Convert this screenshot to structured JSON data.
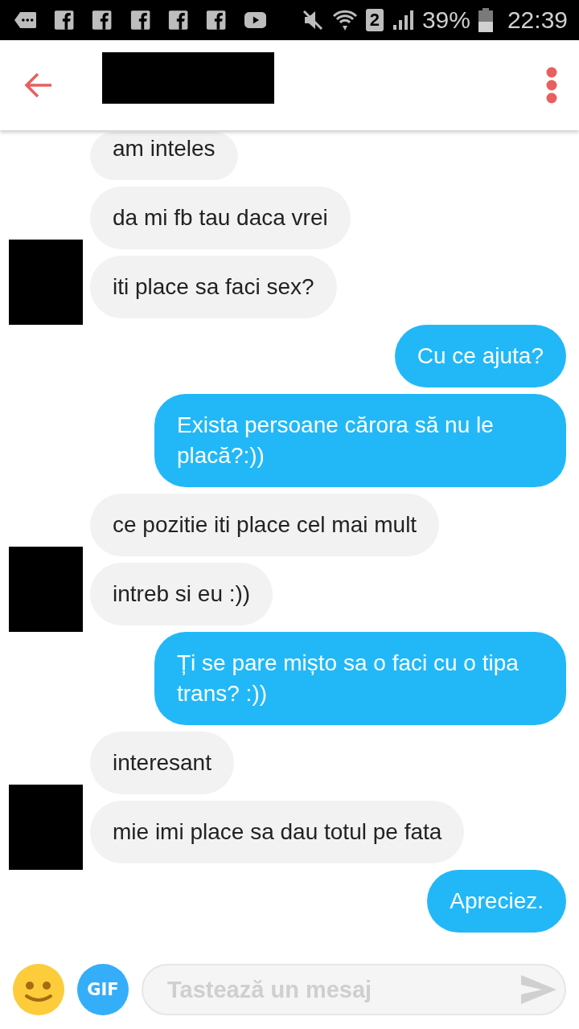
{
  "status_bar": {
    "battery": "39%",
    "time": "22:39",
    "sim": "2"
  },
  "header": {
    "name_redacted": true
  },
  "messages": [
    {
      "kind": "received",
      "text": "am inteles",
      "partial": true,
      "avatar": false
    },
    {
      "kind": "received",
      "text": "da mi fb tau daca vrei",
      "partial": false,
      "avatar": false
    },
    {
      "kind": "received",
      "text": "iti place sa faci sex?",
      "partial": false,
      "avatar": true
    },
    {
      "kind": "sent",
      "text": "Cu ce ajuta?",
      "partial": false,
      "avatar": false
    },
    {
      "kind": "sent",
      "text": "Exista persoane cărora să nu le placă?:))",
      "partial": false,
      "avatar": false
    },
    {
      "kind": "received",
      "text": "ce pozitie iti place cel mai mult",
      "partial": false,
      "avatar": false
    },
    {
      "kind": "received",
      "text": "intreb si eu :))",
      "partial": false,
      "avatar": true
    },
    {
      "kind": "sent",
      "text": "Ți se pare mișto sa o faci cu o tipa trans? :))",
      "partial": false,
      "avatar": false
    },
    {
      "kind": "received",
      "text": "interesant",
      "partial": false,
      "avatar": false
    },
    {
      "kind": "received",
      "text": "mie imi place sa dau totul pe fata",
      "partial": false,
      "avatar": true
    },
    {
      "kind": "sent",
      "text": "Apreciez.",
      "partial": false,
      "avatar": false
    }
  ],
  "composer": {
    "gif_label": "GIF",
    "placeholder": "Tastează un mesaj"
  }
}
